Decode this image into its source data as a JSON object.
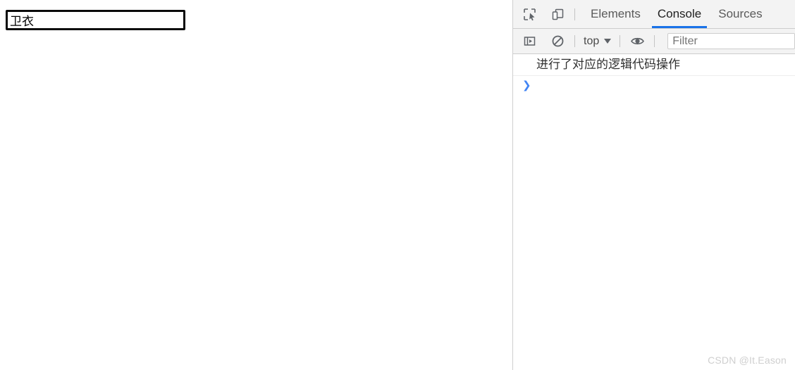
{
  "page": {
    "search_field": {
      "value": "卫衣",
      "placeholder": ""
    }
  },
  "devtools": {
    "tabbar": {
      "inspect_icon": "inspect-element-icon",
      "device_icon": "device-toolbar-icon",
      "tabs": [
        {
          "label": "Elements",
          "active": false
        },
        {
          "label": "Console",
          "active": true
        },
        {
          "label": "Sources",
          "active": false
        }
      ]
    },
    "console_toolbar": {
      "sidebar_icon": "console-sidebar-icon",
      "clear_icon": "clear-console-icon",
      "context_label": "top",
      "caret_icon": "chevron-down-icon",
      "eye_icon": "live-expression-eye-icon",
      "filter_placeholder": "Filter",
      "filter_value": ""
    },
    "console": {
      "messages": [
        {
          "text": "进行了对应的逻辑代码操作"
        }
      ],
      "prompt_symbol": "❯"
    },
    "colors": {
      "active_tab_underline": "#1a73e8",
      "prompt_chevron": "#4285f4",
      "toolbar_bg": "#f3f3f3"
    }
  },
  "watermark": {
    "text": "CSDN @It.Eason"
  }
}
